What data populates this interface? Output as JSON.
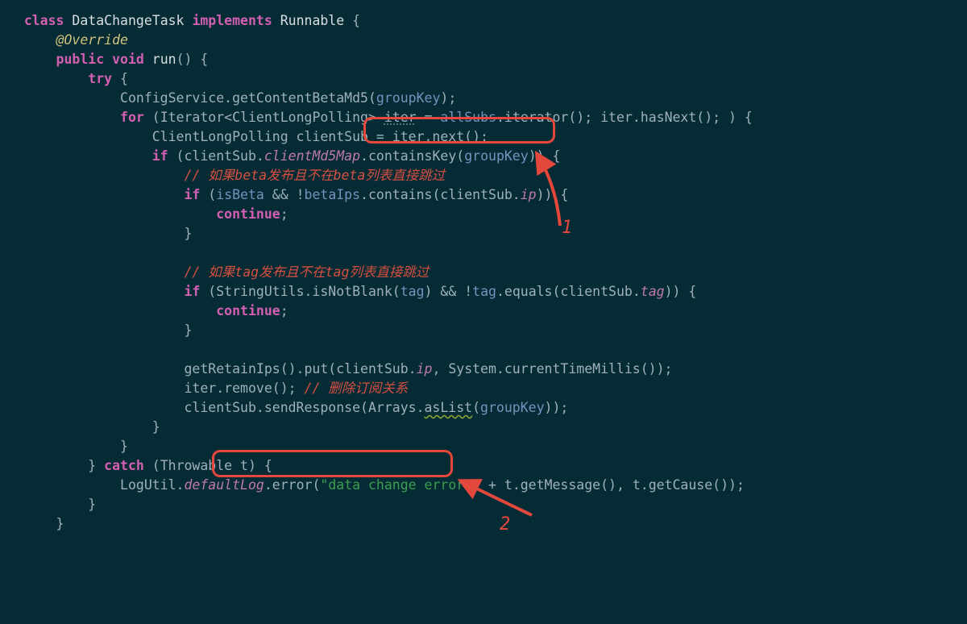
{
  "code": {
    "l1_class": "class",
    "l1_name": "DataChangeTask",
    "l1_impl": "implements",
    "l1_run": "Runnable",
    "l1_obr": " {",
    "l2_ann": "@Override",
    "l3_pub": "public",
    "l3_void": "void",
    "l3_run": "run",
    "l3_rest": "() {",
    "l4_try": "try",
    "l4_obr": " {",
    "l5_a": "ConfigService.getContentBetaMd5(",
    "l5_gk": "groupKey",
    "l5_b": ");",
    "l6_for": "for",
    "l6_a": " (Iterator<ClientLongPolling> ",
    "l6_iter": "iter",
    "l6_eq": " = ",
    "l6_all": "allSubs",
    "l6_b": ".iterator(); iter.hasNext(); ) {",
    "l7": "ClientLongPolling clientSub = iter.next();",
    "l8_if": "if",
    "l8_a": " (clientSub.",
    "l8_fld": "clientMd5Map",
    "l8_b": ".containsKey(",
    "l8_gk": "groupKey",
    "l8_c": ")) {",
    "l9_cmt": "// 如果beta发布且不在beta列表直接跳过",
    "l10_if": "if",
    "l10_a": " (",
    "l10_isb": "isBeta",
    "l10_b": " && !",
    "l10_bip": "betaIps",
    "l10_c": ".contains(clientSub.",
    "l10_ip": "ip",
    "l10_d": ")) {",
    "l11_cont": "continue",
    "l11_semi": ";",
    "l12": "}",
    "l14_cmt": "// 如果tag发布且不在tag列表直接跳过",
    "l15_if": "if",
    "l15_a": " (StringUtils.isNotBlank(",
    "l15_tag": "tag",
    "l15_b": ") && !",
    "l15_tag2": "tag",
    "l15_c": ".equals(clientSub.",
    "l15_tag3": "tag",
    "l15_d": ")) {",
    "l16_cont": "continue",
    "l16_semi": ";",
    "l17": "}",
    "l19_a": "getRetainIps().put(clientSub.",
    "l19_ip": "ip",
    "l19_b": ", System.currentTimeMillis());",
    "l20_a": "iter.remove(); ",
    "l20_cmt": "// 删除订阅关系",
    "l21_a": "clientSub.sendResponse(Arrays.",
    "l21_as": "asList",
    "l21_b": "(",
    "l21_gk": "groupKey",
    "l21_c": "));",
    "l22": "}",
    "l23": "}",
    "l24_cbr": "} ",
    "l24_catch": "catch",
    "l24_a": " (Throwable t) {",
    "l25_a": "LogUtil.",
    "l25_dl": "defaultLog",
    "l25_b": ".error(",
    "l25_str": "\"data change error:\"",
    "l25_c": " + t.getMessage(), t.getCause());",
    "l26": "}",
    "l27": "}"
  },
  "annotations": {
    "label1": "1",
    "label2": "2"
  },
  "colors": {
    "background": "#052b35",
    "default": "#9fb1b6",
    "keyword": "#d35fb3",
    "annotation_yellow": "#d1c27a",
    "param_blue": "#7a90bf",
    "field_pink": "#c07aa9",
    "comment_red": "#d64f40",
    "string_green": "#3c9e4f",
    "highlight_red": "#e4473b"
  }
}
